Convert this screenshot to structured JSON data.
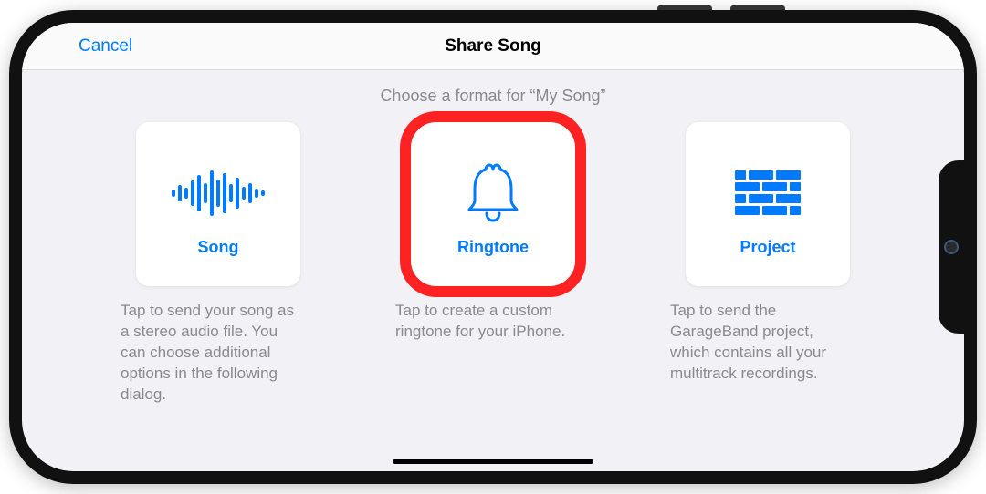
{
  "nav": {
    "cancel": "Cancel",
    "title": "Share Song"
  },
  "subtitle": "Choose a format for “My Song”",
  "options": {
    "song": {
      "label": "Song",
      "desc": "Tap to send your song as a stereo audio file. You can choose additional options in the following dialog."
    },
    "ringtone": {
      "label": "Ringtone",
      "desc": "Tap to create a custom ringtone for your iPhone."
    },
    "project": {
      "label": "Project",
      "desc": "Tap to send the GarageBand project, which contains all your multitrack recordings."
    }
  },
  "colors": {
    "accent": "#007aff",
    "highlight": "#ff2222"
  }
}
